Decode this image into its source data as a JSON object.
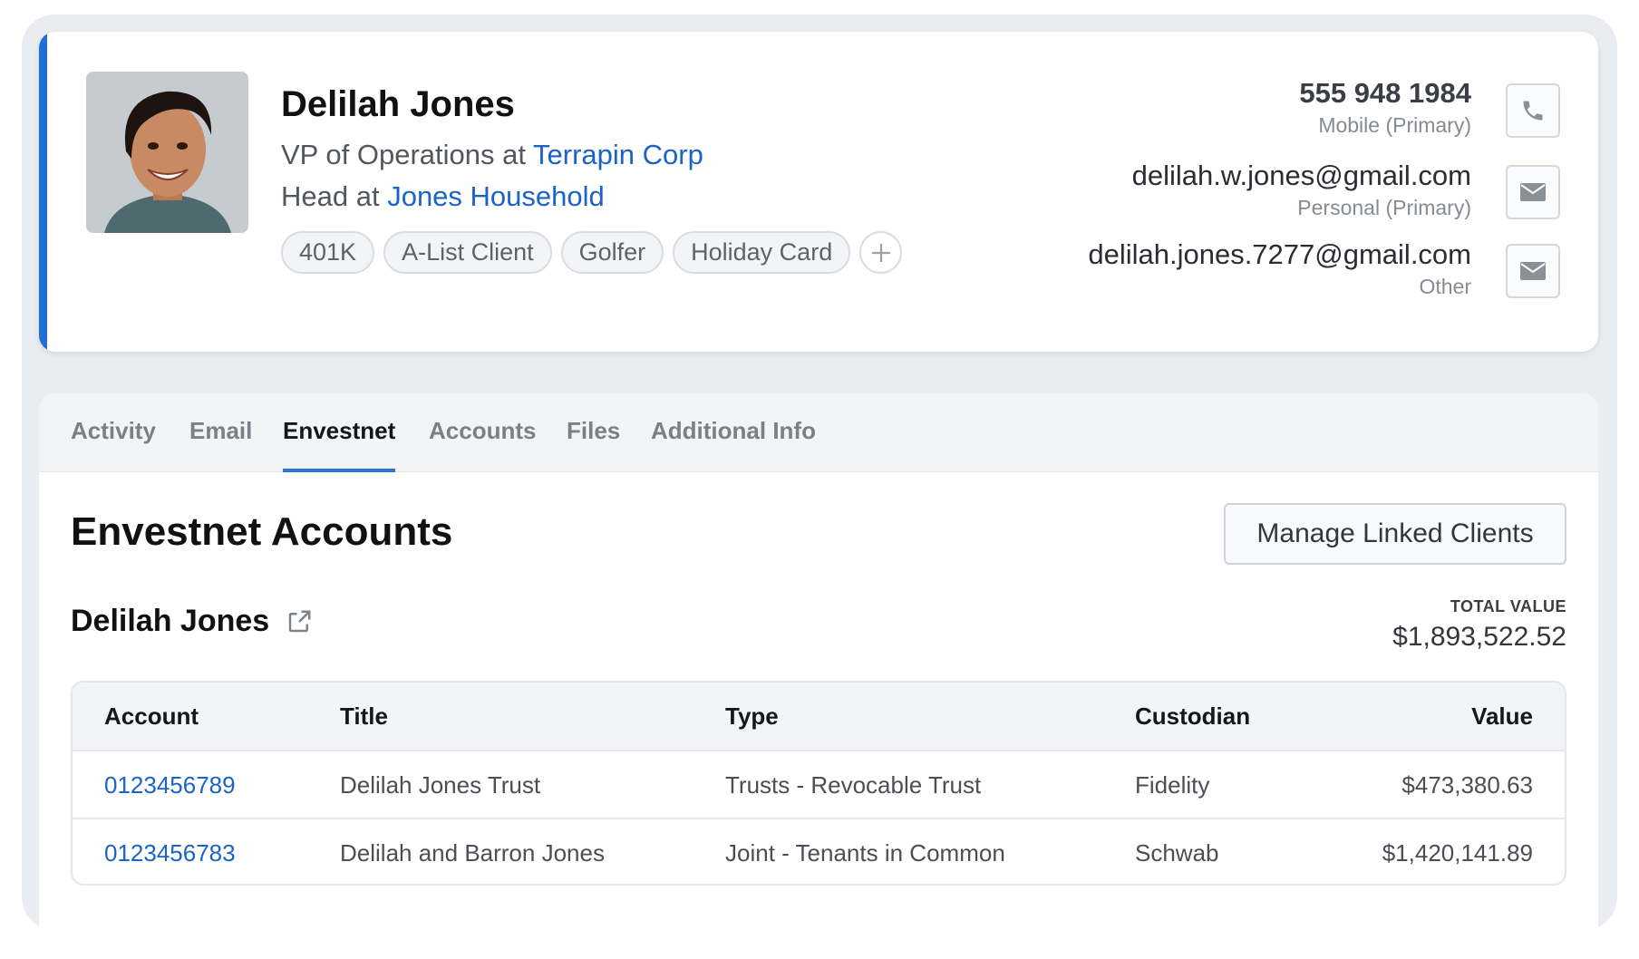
{
  "profile": {
    "name": "Delilah Jones",
    "role_prefix": "VP of Operations at ",
    "company": "Terrapin Corp",
    "household_prefix": "Head at ",
    "household": "Jones Household",
    "tags": [
      "401K",
      "A-List Client",
      "Golfer",
      "Holiday Card"
    ],
    "contacts": [
      {
        "value": "555 948 1984",
        "label": "Mobile (Primary)",
        "icon": "phone-icon"
      },
      {
        "value": "delilah.w.jones@gmail.com",
        "label": "Personal (Primary)",
        "icon": "mail-icon"
      },
      {
        "value": "delilah.jones.7277@gmail.com",
        "label": "Other",
        "icon": "mail-icon"
      }
    ]
  },
  "tabs": [
    {
      "label": "Activity",
      "active": false
    },
    {
      "label": "Email",
      "active": false
    },
    {
      "label": "Envestnet",
      "active": true
    },
    {
      "label": "Accounts",
      "active": false
    },
    {
      "label": "Files",
      "active": false
    },
    {
      "label": "Additional Info",
      "active": false
    }
  ],
  "envestnet": {
    "title": "Envestnet Accounts",
    "manage_button": "Manage Linked Clients",
    "client_name": "Delilah Jones",
    "total_label": "TOTAL VALUE",
    "total_value": "$1,893,522.52",
    "columns": [
      "Account",
      "Title",
      "Type",
      "Custodian",
      "Value"
    ],
    "rows": [
      {
        "account": "0123456789",
        "title": "Delilah Jones Trust",
        "type": "Trusts - Revocable Trust",
        "custodian": "Fidelity",
        "value": "$473,380.63"
      },
      {
        "account": "0123456783",
        "title": "Delilah and Barron Jones",
        "type": "Joint - Tenants in Common",
        "custodian": "Schwab",
        "value": "$1,420,141.89"
      }
    ]
  },
  "colors": {
    "accent": "#1f6ed4",
    "link": "#1a63c8",
    "background": "#e9ecf1"
  }
}
